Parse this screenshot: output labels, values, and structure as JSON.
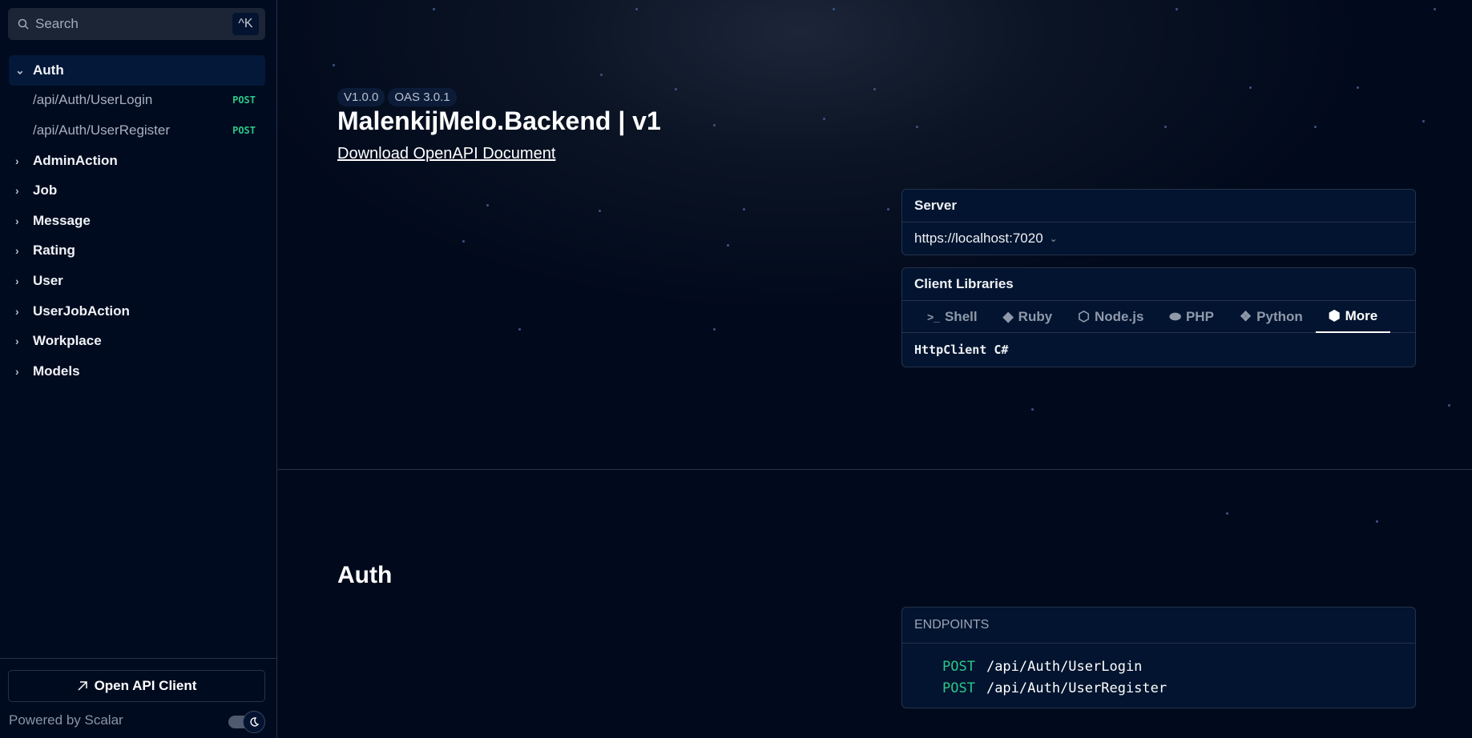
{
  "sidebar": {
    "search_placeholder": "Search",
    "search_shortcut": "^K",
    "groups": [
      {
        "label": "Auth",
        "expanded": true,
        "items": [
          {
            "path": "/api/Auth/UserLogin",
            "method": "POST"
          },
          {
            "path": "/api/Auth/UserRegister",
            "method": "POST"
          }
        ]
      },
      {
        "label": "AdminAction"
      },
      {
        "label": "Job"
      },
      {
        "label": "Message"
      },
      {
        "label": "Rating"
      },
      {
        "label": "User"
      },
      {
        "label": "UserJobAction"
      },
      {
        "label": "Workplace"
      },
      {
        "label": "Models"
      }
    ],
    "open_client_label": "Open API Client",
    "powered_by": "Powered by Scalar"
  },
  "header": {
    "version": "V1.0.0",
    "oas": "OAS 3.0.1",
    "title": "MalenkijMelo.Backend | v1",
    "download_label": "Download OpenAPI Document"
  },
  "server": {
    "label": "Server",
    "url": "https://localhost:7020"
  },
  "client_libraries": {
    "label": "Client Libraries",
    "tabs": [
      "Shell",
      "Ruby",
      "Node.js",
      "PHP",
      "Python",
      "More"
    ],
    "active_tab": "More",
    "selected": "HttpClient C#"
  },
  "section": {
    "title": "Auth",
    "endpoints_label": "ENDPOINTS",
    "endpoints": [
      {
        "method": "POST",
        "path": "/api/Auth/UserLogin"
      },
      {
        "method": "POST",
        "path": "/api/Auth/UserRegister"
      }
    ]
  },
  "colors": {
    "post": "#2bc78a",
    "background": "#010a1c"
  }
}
